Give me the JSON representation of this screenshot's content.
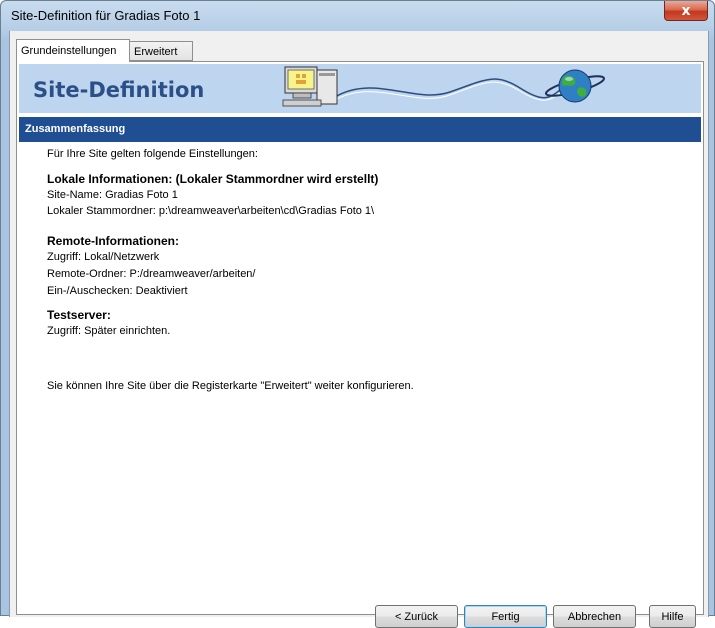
{
  "window": {
    "title": "Site-Definition für Gradias Foto 1",
    "close_glyph": "x"
  },
  "tabs": [
    {
      "label": "Grundeinstellungen",
      "active": true
    },
    {
      "label": "Erweitert",
      "active": false
    }
  ],
  "banner": {
    "title": "Site-Definition",
    "art_icons": [
      "computer-icon",
      "globe-icon"
    ]
  },
  "section": {
    "title": "Zusammenfassung"
  },
  "summary": {
    "intro": "Für Ihre Site gelten folgende Einstellungen:",
    "local": {
      "heading": "Lokale Informationen: (Lokaler Stammordner wird erstellt)",
      "site_name": "Site-Name: Gradias Foto 1",
      "root_folder": "Lokaler Stammordner: p:\\dreamweaver\\arbeiten\\cd\\Gradias Foto 1\\"
    },
    "remote": {
      "heading": "Remote-Informationen:",
      "access": "Zugriff: Lokal/Netzwerk",
      "folder": "Remote-Ordner: P:/dreamweaver/arbeiten/",
      "checkout": "Ein-/Auschecken: Deaktiviert"
    },
    "testserver": {
      "heading": "Testserver:",
      "access": "Zugriff: Später einrichten."
    },
    "footer_note": "Sie können Ihre Site über die Registerkarte \"Erweitert\" weiter konfigurieren."
  },
  "buttons": {
    "back": "< Zurück",
    "finish": "Fertig",
    "cancel": "Abbrechen",
    "help": "Hilfe"
  },
  "colors": {
    "banner_bg": "#bdd5ee",
    "banner_title": "#2b4f86",
    "section_bar": "#1f4e93",
    "close_button": "#c2381e"
  }
}
